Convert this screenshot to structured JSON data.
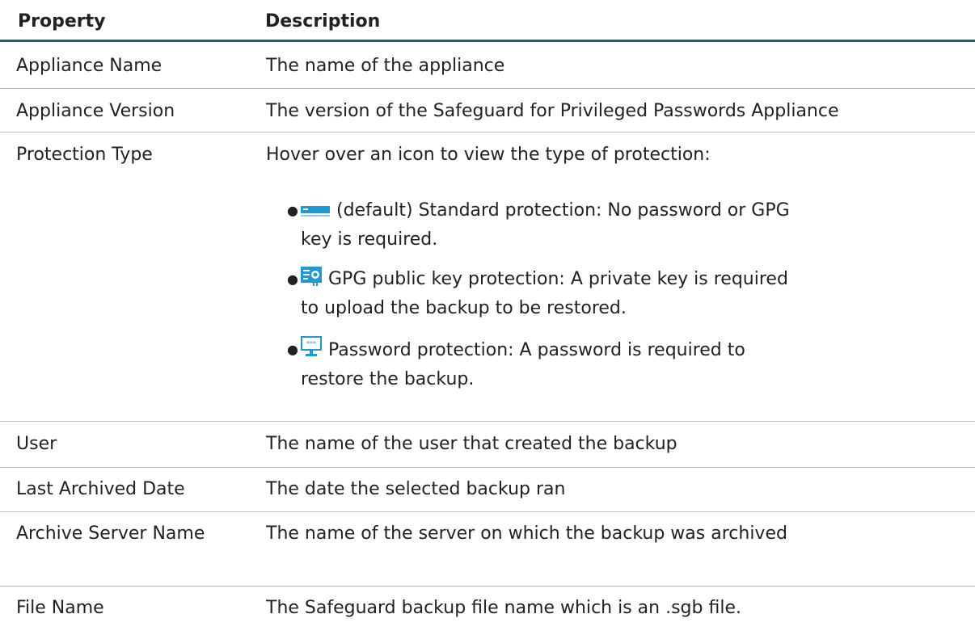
{
  "header": {
    "col_property": "Property",
    "col_description": "Description"
  },
  "rows": [
    {
      "property": "Appliance Name",
      "description": "The name of the appliance"
    },
    {
      "property": "Appliance Version",
      "description": "The version of the Safeguard for Privileged Passwords Appliance"
    },
    {
      "property": "Protection Type",
      "description": "Hover over an icon to view the type of protection:"
    },
    {
      "property": "User",
      "description": "The name of the user that created the backup"
    },
    {
      "property": "Last Archived Date",
      "description": "The date the selected backup ran"
    },
    {
      "property": "Archive Server Name",
      "description": "The name of the server on which the backup was archived"
    },
    {
      "property": "File Name",
      "description": "The Safeguard backup file name which is an .sgb file."
    }
  ],
  "protection_types": [
    {
      "icon": "standard-protection-icon",
      "text": "(default) Standard protection: No password or GPG key is required."
    },
    {
      "icon": "gpg-key-protection-icon",
      "text": "GPG public key protection: A private key is required to upload the backup to be restored."
    },
    {
      "icon": "password-protection-icon",
      "text": "Password protection: A password is required to restore the backup."
    }
  ],
  "colors": {
    "header_rule": "#1f5c78",
    "icon_blue": "#1e9bd7",
    "row_rule": "#b9b9b9"
  }
}
